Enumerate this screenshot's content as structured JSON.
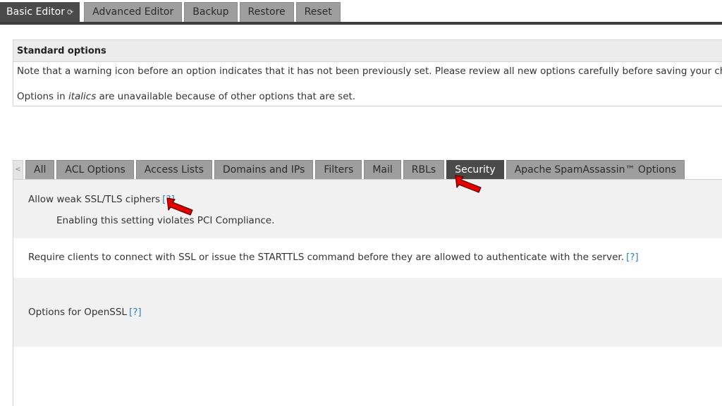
{
  "top_tabs": {
    "basic_editor": "Basic Editor",
    "advanced_editor": "Advanced Editor",
    "backup": "Backup",
    "restore": "Restore",
    "reset": "Reset"
  },
  "standard_options": {
    "header": "Standard options",
    "warning_note": "Note that a warning icon before an option indicates that it has not been previously set. Please review all new options carefully before saving your changes.",
    "italics_note_prefix": "Options in ",
    "italics_word": "italics",
    "italics_note_suffix": " are unavailable because of other options that are set."
  },
  "section_tabs": {
    "scroll_left": "<",
    "items": [
      "All",
      "ACL Options",
      "Access Lists",
      "Domains and IPs",
      "Filters",
      "Mail",
      "RBLs",
      "Security",
      "Apache SpamAssassin™ Options"
    ]
  },
  "options": {
    "weak_ciphers_label": "Allow weak SSL/TLS ciphers",
    "weak_ciphers_note": "Enabling this setting violates PCI Compliance.",
    "require_ssl_label": "Require clients to connect with SSL or issue the STARTTLS command before they are allowed to authenticate with the server.",
    "openssl_label": "Options for OpenSSL",
    "help_link": "[?]"
  },
  "colors": {
    "active_tab": "#4a4a4a",
    "inactive_tab": "#9e9e9e",
    "help_link": "#2f84c4",
    "annotation_arrow": "#e00000"
  },
  "icons": {
    "refresh": "refresh-icon",
    "annotation": "red-pointer-arrow"
  }
}
